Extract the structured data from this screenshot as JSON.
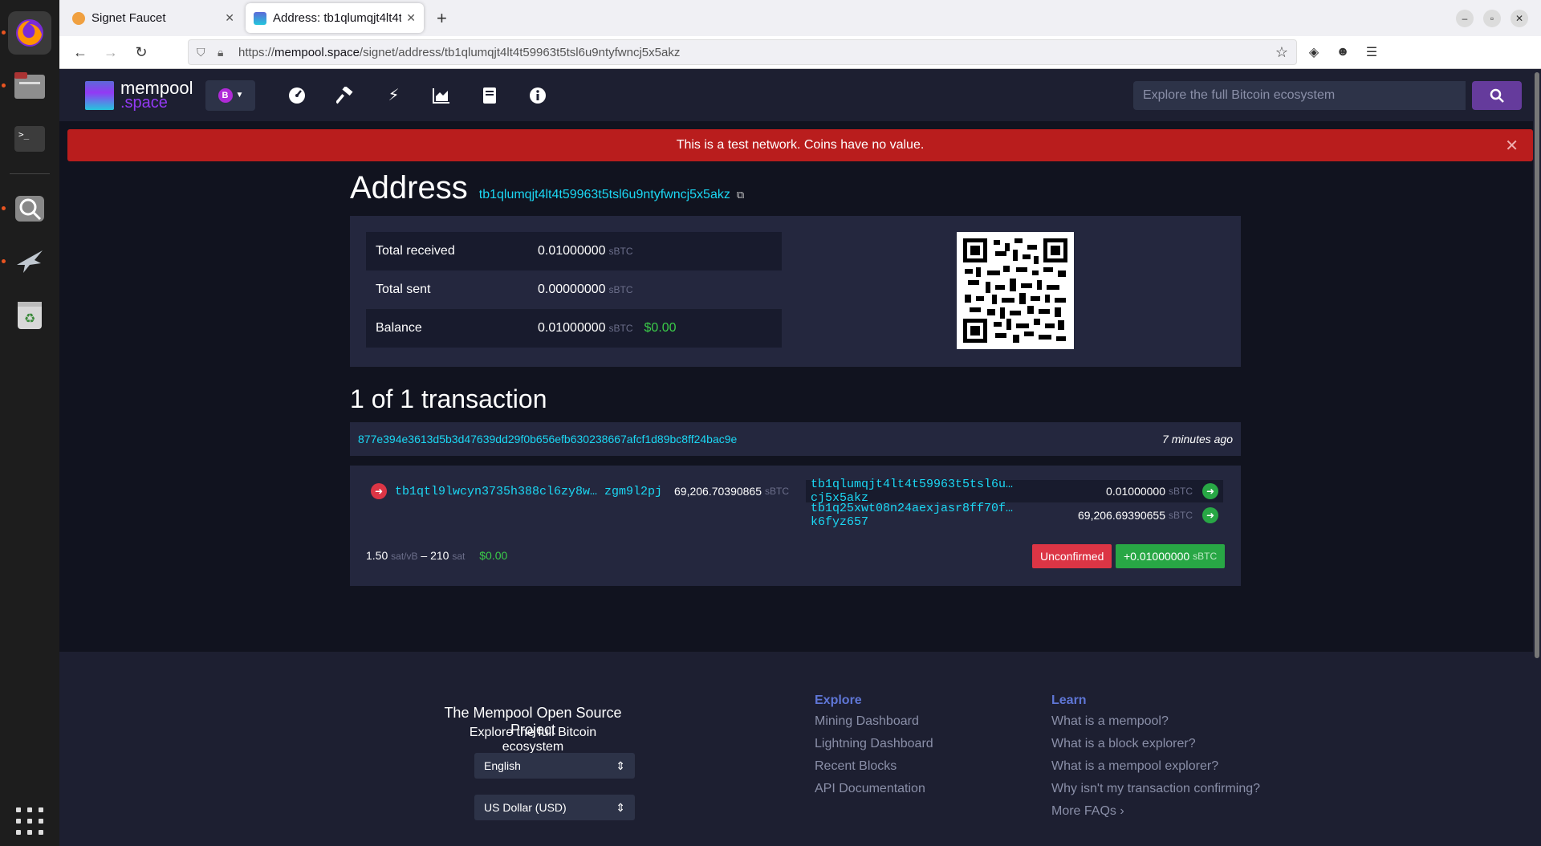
{
  "dock": {
    "items": [
      "firefox-icon",
      "files-icon",
      "terminal-icon",
      "search-app-icon",
      "bird-app-icon",
      "trash-icon"
    ]
  },
  "browser": {
    "tabs": [
      {
        "title": "Signet Faucet",
        "icon_color": "#f7931a"
      },
      {
        "title": "Address: tb1qlumqjt4lt4t",
        "icon_color": "#2d3348"
      }
    ],
    "url_prefix": "https://",
    "url_host": "mempool.space",
    "url_path": "/signet/address/tb1qlumqjt4lt4t59963t5tsl6u9ntyfwncj5x5akz"
  },
  "header": {
    "logo_line1": "mempool",
    "logo_line2": ".space",
    "network_symbol": "B",
    "search_placeholder": "Explore the full Bitcoin ecosystem"
  },
  "banner": {
    "text": "This is a test network. Coins have no value."
  },
  "address": {
    "title": "Address",
    "value": "tb1qlumqjt4lt4t59963t5tsl6u9ntyfwncj5x5akz",
    "rows": [
      {
        "label": "Total received",
        "amount": "0.01000000",
        "unit": "sBTC",
        "fiat": ""
      },
      {
        "label": "Total sent",
        "amount": "0.00000000",
        "unit": "sBTC",
        "fiat": ""
      },
      {
        "label": "Balance",
        "amount": "0.01000000",
        "unit": "sBTC",
        "fiat": "$0.00"
      }
    ]
  },
  "transactions": {
    "heading": "1 of 1 transaction",
    "txid": "877e394e3613d5b3d47639dd29f0b656efb630238667afcf1d89bc8ff24bac9e",
    "time": "7 minutes ago",
    "input": {
      "address": "tb1qtl9lwcyn3735h388cl6zy8w… zgm9l2pj",
      "amount": "69,206.70390865",
      "unit": "sBTC"
    },
    "outputs": [
      {
        "address": "tb1qlumqjt4lt4t59963t5tsl6u… cj5x5akz",
        "amount": "0.01000000",
        "unit": "sBTC"
      },
      {
        "address": "tb1q25xwt08n24aexjasr8ff70f… k6fyz657",
        "amount": "69,206.69390655",
        "unit": "sBTC"
      }
    ],
    "fee_rate": "1.50",
    "fee_rate_unit": "sat/vB",
    "dash": "–",
    "fee": "210",
    "fee_unit": "sat",
    "fee_fiat": "$0.00",
    "status": "Unconfirmed",
    "net_amount": "+0.01000000",
    "net_unit": "sBTC"
  },
  "footer": {
    "project": "The Mempool Open Source Project",
    "tagline": "Explore the full Bitcoin ecosystem",
    "language": "English",
    "currency": "US Dollar (USD)",
    "explore": {
      "heading": "Explore",
      "links": [
        "Mining Dashboard",
        "Lightning Dashboard",
        "Recent Blocks",
        "API Documentation"
      ]
    },
    "learn": {
      "heading": "Learn",
      "links": [
        "What is a mempool?",
        "What is a block explorer?",
        "What is a mempool explorer?",
        "Why isn't my transaction confirming?",
        "More FAQs ›"
      ]
    }
  }
}
